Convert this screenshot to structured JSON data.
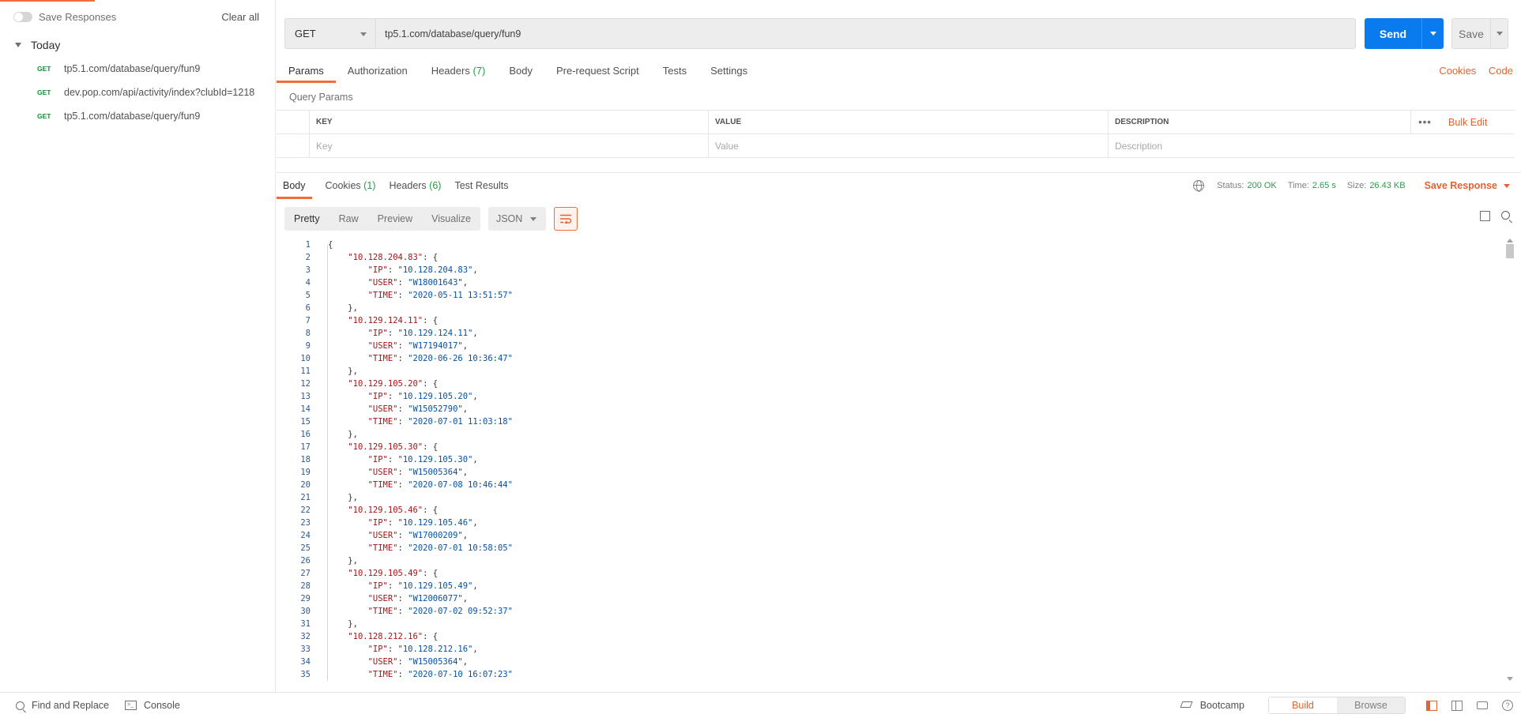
{
  "sidebar": {
    "save_responses_label": "Save Responses",
    "clear_all_label": "Clear all",
    "group_label": "Today",
    "history": [
      {
        "method": "GET",
        "url": "tp5.1.com/database/query/fun9"
      },
      {
        "method": "GET",
        "url": "dev.pop.com/api/activity/index?clubId=1218"
      },
      {
        "method": "GET",
        "url": "tp5.1.com/database/query/fun9"
      }
    ]
  },
  "request": {
    "method": "GET",
    "url": "tp5.1.com/database/query/fun9",
    "send_label": "Send",
    "save_label": "Save"
  },
  "request_tabs": {
    "params": "Params",
    "authorization": "Authorization",
    "headers": "Headers",
    "headers_count": "(7)",
    "body": "Body",
    "prerequest": "Pre-request Script",
    "tests": "Tests",
    "settings": "Settings",
    "cookies": "Cookies",
    "code": "Code"
  },
  "query_params": {
    "title": "Query Params",
    "columns": {
      "key": "KEY",
      "value": "VALUE",
      "description": "DESCRIPTION"
    },
    "more": "•••",
    "bulk_edit": "Bulk Edit",
    "placeholders": {
      "key": "Key",
      "value": "Value",
      "description": "Description"
    }
  },
  "response_tabs": {
    "body": "Body",
    "cookies": "Cookies",
    "cookies_count": "(1)",
    "headers": "Headers",
    "headers_count": "(6)",
    "test_results": "Test Results"
  },
  "status": {
    "status_label": "Status:",
    "status_value": "200 OK",
    "time_label": "Time:",
    "time_value": "2.65 s",
    "size_label": "Size:",
    "size_value": "26.43 KB",
    "save_response": "Save Response"
  },
  "view": {
    "modes": [
      "Pretty",
      "Raw",
      "Preview",
      "Visualize"
    ],
    "active_mode": "Pretty",
    "format": "JSON"
  },
  "response_body": {
    "entries": [
      {
        "key": "10.128.204.83",
        "IP": "10.128.204.83",
        "USER": "W18001643",
        "TIME": "2020-05-11 13:51:57"
      },
      {
        "key": "10.129.124.11",
        "IP": "10.129.124.11",
        "USER": "W17194017",
        "TIME": "2020-06-26 10:36:47"
      },
      {
        "key": "10.129.105.20",
        "IP": "10.129.105.20",
        "USER": "W15052790",
        "TIME": "2020-07-01 11:03:18"
      },
      {
        "key": "10.129.105.30",
        "IP": "10.129.105.30",
        "USER": "W15005364",
        "TIME": "2020-07-08 10:46:44"
      },
      {
        "key": "10.129.105.46",
        "IP": "10.129.105.46",
        "USER": "W17000209",
        "TIME": "2020-07-01 10:58:05"
      },
      {
        "key": "10.129.105.49",
        "IP": "10.129.105.49",
        "USER": "W12006077",
        "TIME": "2020-07-02 09:52:37"
      },
      {
        "key": "10.128.212.16",
        "IP": "10.128.212.16",
        "USER": "W15005364",
        "TIME": "2020-07-10 16:07:23"
      }
    ]
  },
  "footer": {
    "find_replace": "Find and Replace",
    "console": "Console",
    "bootcamp": "Bootcamp",
    "build": "Build",
    "browse": "Browse",
    "help": "?"
  },
  "colors": {
    "accent": "#f26b3a",
    "send_blue": "#097bed",
    "status_green": "#2a9a4a",
    "json_key": "#a31515",
    "json_string": "#0451a5"
  },
  "icons": [
    "toggle-icon",
    "caret-down-icon",
    "globe-icon",
    "wrap-lines-icon",
    "copy-icon",
    "search-icon",
    "find-icon",
    "console-icon",
    "bootcamp-icon",
    "two-pane-icon",
    "keyboard-icon",
    "help-icon"
  ]
}
